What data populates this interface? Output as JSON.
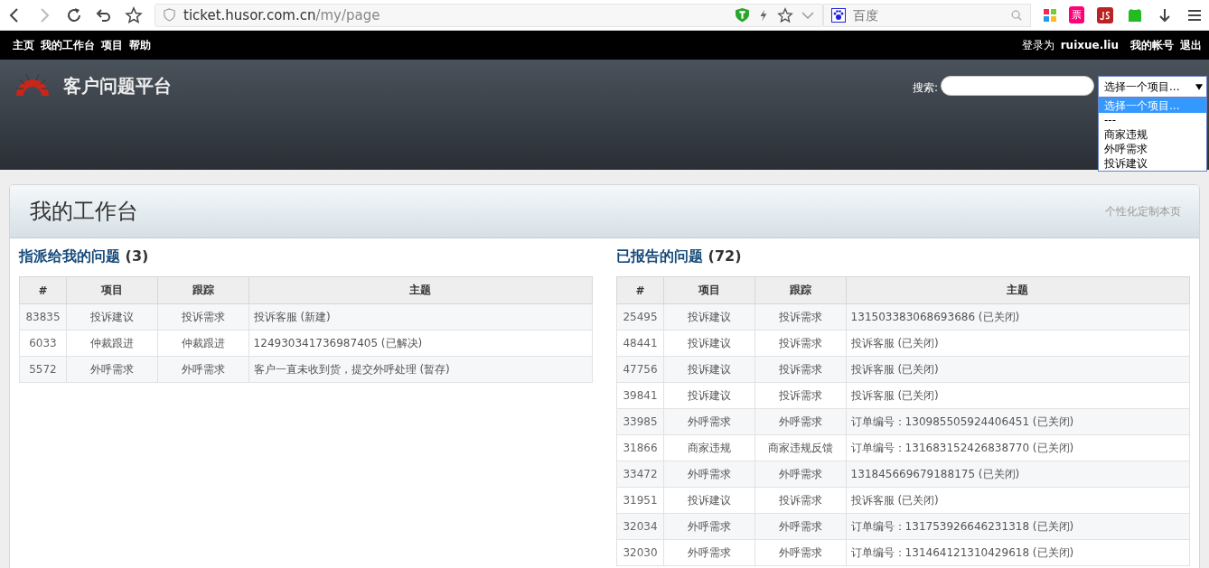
{
  "browser": {
    "url_host": "ticket.husor.com.cn",
    "url_path": "/my/page",
    "search_placeholder": "百度",
    "extension_label": "票"
  },
  "top_menu": {
    "items": [
      "主页",
      "我的工作台",
      "项目",
      "帮助"
    ],
    "logged_in_label": "登录为",
    "user": "ruixue.liu",
    "account_links": [
      "我的帐号",
      "退出"
    ]
  },
  "header": {
    "title": "客户问题平台",
    "search_label": "搜索:",
    "project_select": {
      "value": "选择一个项目...",
      "expanded": true,
      "options": [
        {
          "label": "选择一个项目...",
          "selected": true
        },
        {
          "label": "---",
          "selected": false
        },
        {
          "label": "商家违规",
          "selected": false
        },
        {
          "label": "外呼需求",
          "selected": false
        },
        {
          "label": "投诉建议",
          "selected": false
        }
      ]
    }
  },
  "page": {
    "title": "我的工作台",
    "personalize_link": "个性化定制本页"
  },
  "panels": [
    {
      "title": "指派给我的问题",
      "count": "(3)",
      "columns": [
        "#",
        "项目",
        "跟踪",
        "主题"
      ],
      "rows": [
        [
          "83835",
          "投诉建议",
          "投诉需求",
          "投诉客服 (新建)"
        ],
        [
          "6033",
          "仲裁跟进",
          "仲裁跟进",
          "124930341736987405 (已解决)"
        ],
        [
          "5572",
          "外呼需求",
          "外呼需求",
          "客户一直未收到货，提交外呼处理 (暂存)"
        ]
      ]
    },
    {
      "title": "已报告的问题",
      "count": "(72)",
      "columns": [
        "#",
        "项目",
        "跟踪",
        "主题"
      ],
      "rows": [
        [
          "25495",
          "投诉建议",
          "投诉需求",
          "131503383068693686 (已关闭)"
        ],
        [
          "48441",
          "投诉建议",
          "投诉需求",
          "投诉客服 (已关闭)"
        ],
        [
          "47756",
          "投诉建议",
          "投诉需求",
          "投诉客服 (已关闭)"
        ],
        [
          "39841",
          "投诉建议",
          "投诉需求",
          "投诉客服 (已关闭)"
        ],
        [
          "33985",
          "外呼需求",
          "外呼需求",
          "订单编号：130985505924406451 (已关闭)"
        ],
        [
          "31866",
          "商家违规",
          "商家违规反馈",
          "订单编号：131683152426838770 (已关闭)"
        ],
        [
          "33472",
          "外呼需求",
          "外呼需求",
          "131845669679188175 (已关闭)"
        ],
        [
          "31951",
          "投诉建议",
          "投诉需求",
          "投诉客服 (已关闭)"
        ],
        [
          "32034",
          "外呼需求",
          "外呼需求",
          "订单编号：131753926646231318 (已关闭)"
        ],
        [
          "32030",
          "外呼需求",
          "外呼需求",
          "订单编号：131464121310429618 (已关闭)"
        ]
      ]
    }
  ]
}
